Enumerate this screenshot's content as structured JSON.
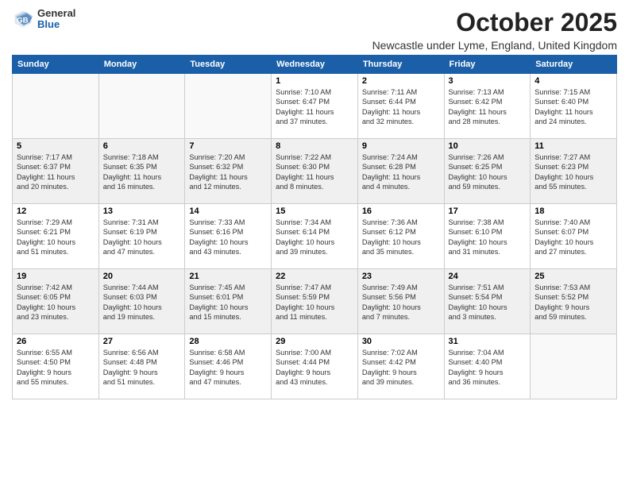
{
  "logo": {
    "general": "General",
    "blue": "Blue"
  },
  "title": "October 2025",
  "location": "Newcastle under Lyme, England, United Kingdom",
  "days_header": [
    "Sunday",
    "Monday",
    "Tuesday",
    "Wednesday",
    "Thursday",
    "Friday",
    "Saturday"
  ],
  "weeks": [
    {
      "shade": "white",
      "days": [
        {
          "num": "",
          "detail": ""
        },
        {
          "num": "",
          "detail": ""
        },
        {
          "num": "",
          "detail": ""
        },
        {
          "num": "1",
          "detail": "Sunrise: 7:10 AM\nSunset: 6:47 PM\nDaylight: 11 hours\nand 37 minutes."
        },
        {
          "num": "2",
          "detail": "Sunrise: 7:11 AM\nSunset: 6:44 PM\nDaylight: 11 hours\nand 32 minutes."
        },
        {
          "num": "3",
          "detail": "Sunrise: 7:13 AM\nSunset: 6:42 PM\nDaylight: 11 hours\nand 28 minutes."
        },
        {
          "num": "4",
          "detail": "Sunrise: 7:15 AM\nSunset: 6:40 PM\nDaylight: 11 hours\nand 24 minutes."
        }
      ]
    },
    {
      "shade": "shaded",
      "days": [
        {
          "num": "5",
          "detail": "Sunrise: 7:17 AM\nSunset: 6:37 PM\nDaylight: 11 hours\nand 20 minutes."
        },
        {
          "num": "6",
          "detail": "Sunrise: 7:18 AM\nSunset: 6:35 PM\nDaylight: 11 hours\nand 16 minutes."
        },
        {
          "num": "7",
          "detail": "Sunrise: 7:20 AM\nSunset: 6:32 PM\nDaylight: 11 hours\nand 12 minutes."
        },
        {
          "num": "8",
          "detail": "Sunrise: 7:22 AM\nSunset: 6:30 PM\nDaylight: 11 hours\nand 8 minutes."
        },
        {
          "num": "9",
          "detail": "Sunrise: 7:24 AM\nSunset: 6:28 PM\nDaylight: 11 hours\nand 4 minutes."
        },
        {
          "num": "10",
          "detail": "Sunrise: 7:26 AM\nSunset: 6:25 PM\nDaylight: 10 hours\nand 59 minutes."
        },
        {
          "num": "11",
          "detail": "Sunrise: 7:27 AM\nSunset: 6:23 PM\nDaylight: 10 hours\nand 55 minutes."
        }
      ]
    },
    {
      "shade": "white",
      "days": [
        {
          "num": "12",
          "detail": "Sunrise: 7:29 AM\nSunset: 6:21 PM\nDaylight: 10 hours\nand 51 minutes."
        },
        {
          "num": "13",
          "detail": "Sunrise: 7:31 AM\nSunset: 6:19 PM\nDaylight: 10 hours\nand 47 minutes."
        },
        {
          "num": "14",
          "detail": "Sunrise: 7:33 AM\nSunset: 6:16 PM\nDaylight: 10 hours\nand 43 minutes."
        },
        {
          "num": "15",
          "detail": "Sunrise: 7:34 AM\nSunset: 6:14 PM\nDaylight: 10 hours\nand 39 minutes."
        },
        {
          "num": "16",
          "detail": "Sunrise: 7:36 AM\nSunset: 6:12 PM\nDaylight: 10 hours\nand 35 minutes."
        },
        {
          "num": "17",
          "detail": "Sunrise: 7:38 AM\nSunset: 6:10 PM\nDaylight: 10 hours\nand 31 minutes."
        },
        {
          "num": "18",
          "detail": "Sunrise: 7:40 AM\nSunset: 6:07 PM\nDaylight: 10 hours\nand 27 minutes."
        }
      ]
    },
    {
      "shade": "shaded",
      "days": [
        {
          "num": "19",
          "detail": "Sunrise: 7:42 AM\nSunset: 6:05 PM\nDaylight: 10 hours\nand 23 minutes."
        },
        {
          "num": "20",
          "detail": "Sunrise: 7:44 AM\nSunset: 6:03 PM\nDaylight: 10 hours\nand 19 minutes."
        },
        {
          "num": "21",
          "detail": "Sunrise: 7:45 AM\nSunset: 6:01 PM\nDaylight: 10 hours\nand 15 minutes."
        },
        {
          "num": "22",
          "detail": "Sunrise: 7:47 AM\nSunset: 5:59 PM\nDaylight: 10 hours\nand 11 minutes."
        },
        {
          "num": "23",
          "detail": "Sunrise: 7:49 AM\nSunset: 5:56 PM\nDaylight: 10 hours\nand 7 minutes."
        },
        {
          "num": "24",
          "detail": "Sunrise: 7:51 AM\nSunset: 5:54 PM\nDaylight: 10 hours\nand 3 minutes."
        },
        {
          "num": "25",
          "detail": "Sunrise: 7:53 AM\nSunset: 5:52 PM\nDaylight: 9 hours\nand 59 minutes."
        }
      ]
    },
    {
      "shade": "white",
      "days": [
        {
          "num": "26",
          "detail": "Sunrise: 6:55 AM\nSunset: 4:50 PM\nDaylight: 9 hours\nand 55 minutes."
        },
        {
          "num": "27",
          "detail": "Sunrise: 6:56 AM\nSunset: 4:48 PM\nDaylight: 9 hours\nand 51 minutes."
        },
        {
          "num": "28",
          "detail": "Sunrise: 6:58 AM\nSunset: 4:46 PM\nDaylight: 9 hours\nand 47 minutes."
        },
        {
          "num": "29",
          "detail": "Sunrise: 7:00 AM\nSunset: 4:44 PM\nDaylight: 9 hours\nand 43 minutes."
        },
        {
          "num": "30",
          "detail": "Sunrise: 7:02 AM\nSunset: 4:42 PM\nDaylight: 9 hours\nand 39 minutes."
        },
        {
          "num": "31",
          "detail": "Sunrise: 7:04 AM\nSunset: 4:40 PM\nDaylight: 9 hours\nand 36 minutes."
        },
        {
          "num": "",
          "detail": ""
        }
      ]
    }
  ]
}
